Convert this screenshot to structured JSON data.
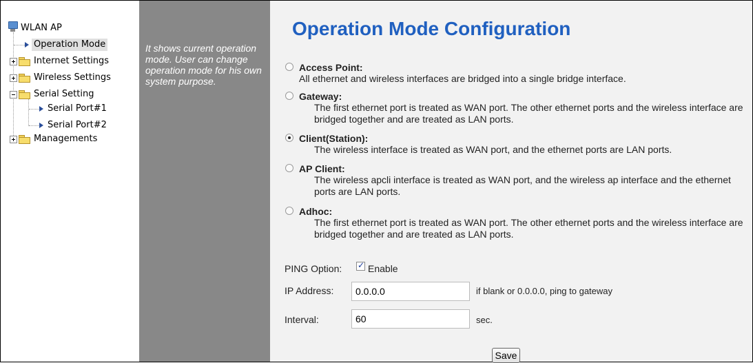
{
  "tree": {
    "root": "WLAN AP",
    "items": [
      {
        "label": "Operation Mode"
      },
      {
        "label": "Internet Settings"
      },
      {
        "label": "Wireless Settings"
      },
      {
        "label": "Serial Setting"
      },
      {
        "label": "Serial Port#1"
      },
      {
        "label": "Serial Port#2"
      },
      {
        "label": "Managements"
      }
    ]
  },
  "help": {
    "text": "It shows current operation mode. User can change operation mode for his own system purpose."
  },
  "main": {
    "title": "Operation Mode Configuration",
    "selected_mode": "Client(Station):",
    "options": [
      {
        "label": "Access Point:",
        "desc": "All ethernet and wireless interfaces are bridged into a single bridge interface."
      },
      {
        "label": "Gateway:",
        "desc": "The first ethernet port is treated as WAN port. The other ethernet ports and the wireless interface are bridged together and are treated as LAN ports."
      },
      {
        "label": "Client(Station):",
        "desc": "The wireless interface is treated as WAN port, and the ethernet ports are LAN ports."
      },
      {
        "label": "AP Client:",
        "desc": "The wireless apcli interface is treated as WAN port, and the wireless ap interface and the ethernet ports are LAN ports."
      },
      {
        "label": "Adhoc:",
        "desc": "The first ethernet port is treated as WAN port. The other ethernet ports and the wireless interface are bridged together and are treated as LAN ports."
      }
    ],
    "ping": {
      "label": "PING Option:",
      "checked": true,
      "enable_label": "Enable"
    },
    "ip": {
      "label": "IP Address:",
      "value": "0.0.0.0",
      "hint": "if blank or 0.0.0.0, ping to gateway"
    },
    "interval": {
      "label": "Interval:",
      "value": "60",
      "unit": "sec."
    },
    "save_label": "Save"
  }
}
